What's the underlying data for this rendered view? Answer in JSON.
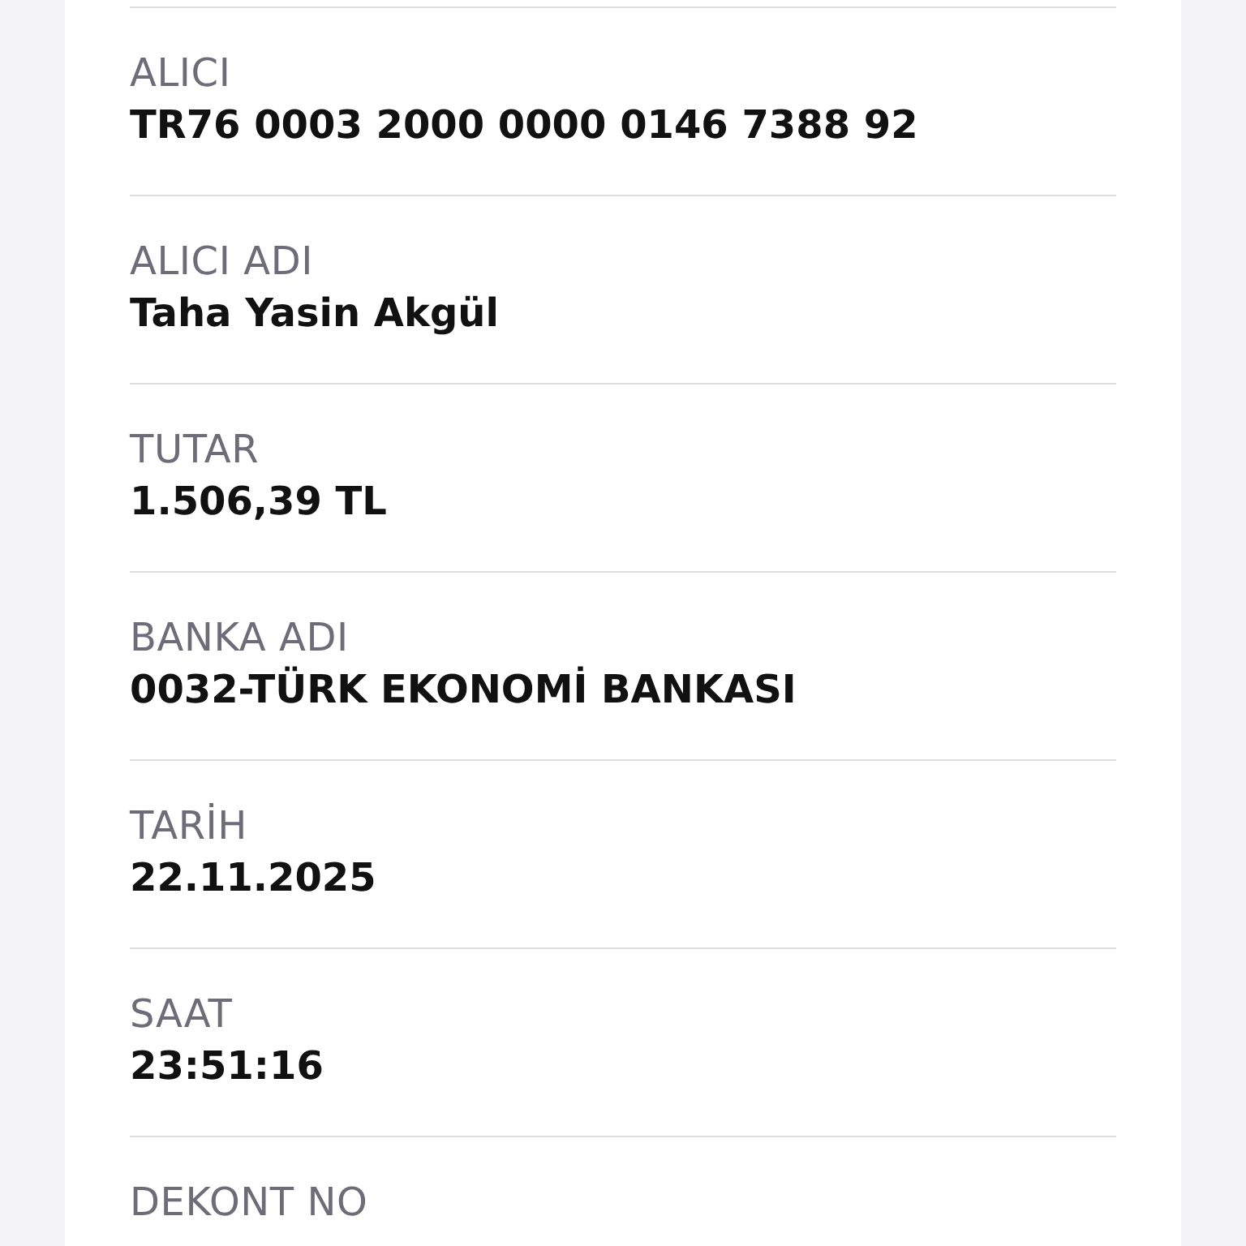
{
  "fields": [
    {
      "label": "ALICI",
      "value": "TR76 0003 2000 0000 0146 7388 92"
    },
    {
      "label": "ALICI ADI",
      "value": "Taha Yasin Akgül"
    },
    {
      "label": "TUTAR",
      "value": "1.506,39 TL"
    },
    {
      "label": "BANKA ADI",
      "value": "0032-TÜRK EKONOMİ BANKASI"
    },
    {
      "label": "TARİH",
      "value": "22.11.2025"
    },
    {
      "label": "SAAT",
      "value": "23:51:16"
    },
    {
      "label": "DEKONT NO"
    }
  ]
}
